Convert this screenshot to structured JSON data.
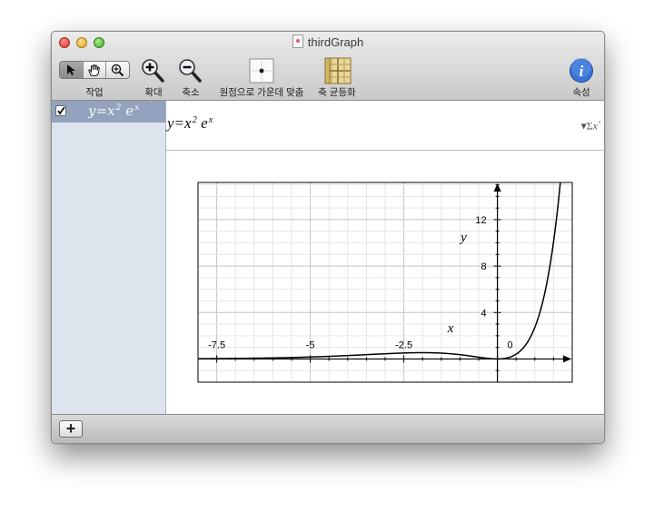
{
  "window": {
    "title": "thirdGraph",
    "buttons": [
      "close",
      "minimize",
      "zoom"
    ]
  },
  "toolbar": {
    "mode_label": "작업",
    "zoom_in_label": "확대",
    "zoom_out_label": "축소",
    "center_origin_label": "원점으로 가운데 맞춤",
    "equalize_axes_label": "축 균등화",
    "inspector_label": "속성",
    "mode_tools": [
      "pointer-icon",
      "hand-icon",
      "magnify-icon"
    ],
    "selected_mode": "pointer"
  },
  "sidebar": {
    "items": [
      {
        "checked": true,
        "y": "y",
        "eq": "=",
        "x": "x",
        "exp": "2",
        "e": "e",
        "e_exp": "x"
      }
    ]
  },
  "editor": {
    "y": "y",
    "eq": "=",
    "x": "x",
    "exp": "2",
    "e": "e",
    "e_exp": "x",
    "sigma_button": "Σ"
  },
  "chart_data": {
    "type": "line",
    "series": [
      {
        "function": "x^2 * e^x"
      }
    ],
    "x_ticks": [
      "-7.5",
      "-5",
      "-2.5",
      "0"
    ],
    "y_ticks": [
      "4",
      "8",
      "12"
    ],
    "xlabel": "x",
    "ylabel": "y",
    "xlim": [
      -8,
      2
    ],
    "ylim": [
      -2,
      15.2
    ],
    "grid": true,
    "colors": {
      "curve": "#000000",
      "grid_major": "#c4c4c4",
      "grid_minor": "#e6e6e6"
    }
  },
  "bottom": {
    "add_button": "+"
  }
}
